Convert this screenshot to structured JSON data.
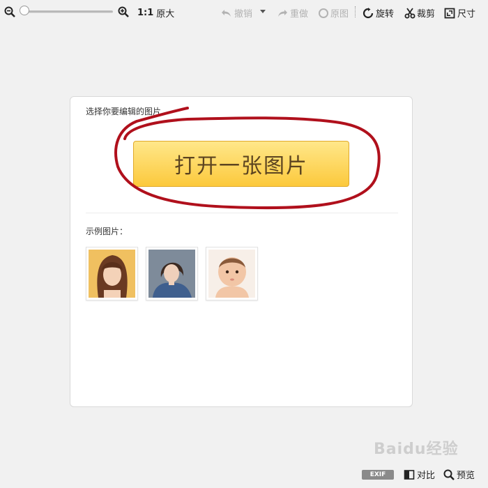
{
  "toolbar": {
    "ratio_label": "1:1",
    "original_size_label": "原大",
    "undo_label": "撤销",
    "redo_label": "重做",
    "original_label": "原图",
    "rotate_label": "旋转",
    "crop_label": "裁剪",
    "size_label": "尺寸",
    "zoom_level": 0
  },
  "card": {
    "select_label": "选择你要编辑的图片",
    "open_button_label": "打开一张图片",
    "examples_label": "示例图片："
  },
  "bottom": {
    "exif_label": "EXIF",
    "compare_label": "对比",
    "preview_label": "预览",
    "watermark": "Baidu经验"
  },
  "colors": {
    "button_top": "#ffe78a",
    "button_bottom": "#fcc93c",
    "annotation_red": "#b0101c",
    "background": "#f1f1f1"
  }
}
